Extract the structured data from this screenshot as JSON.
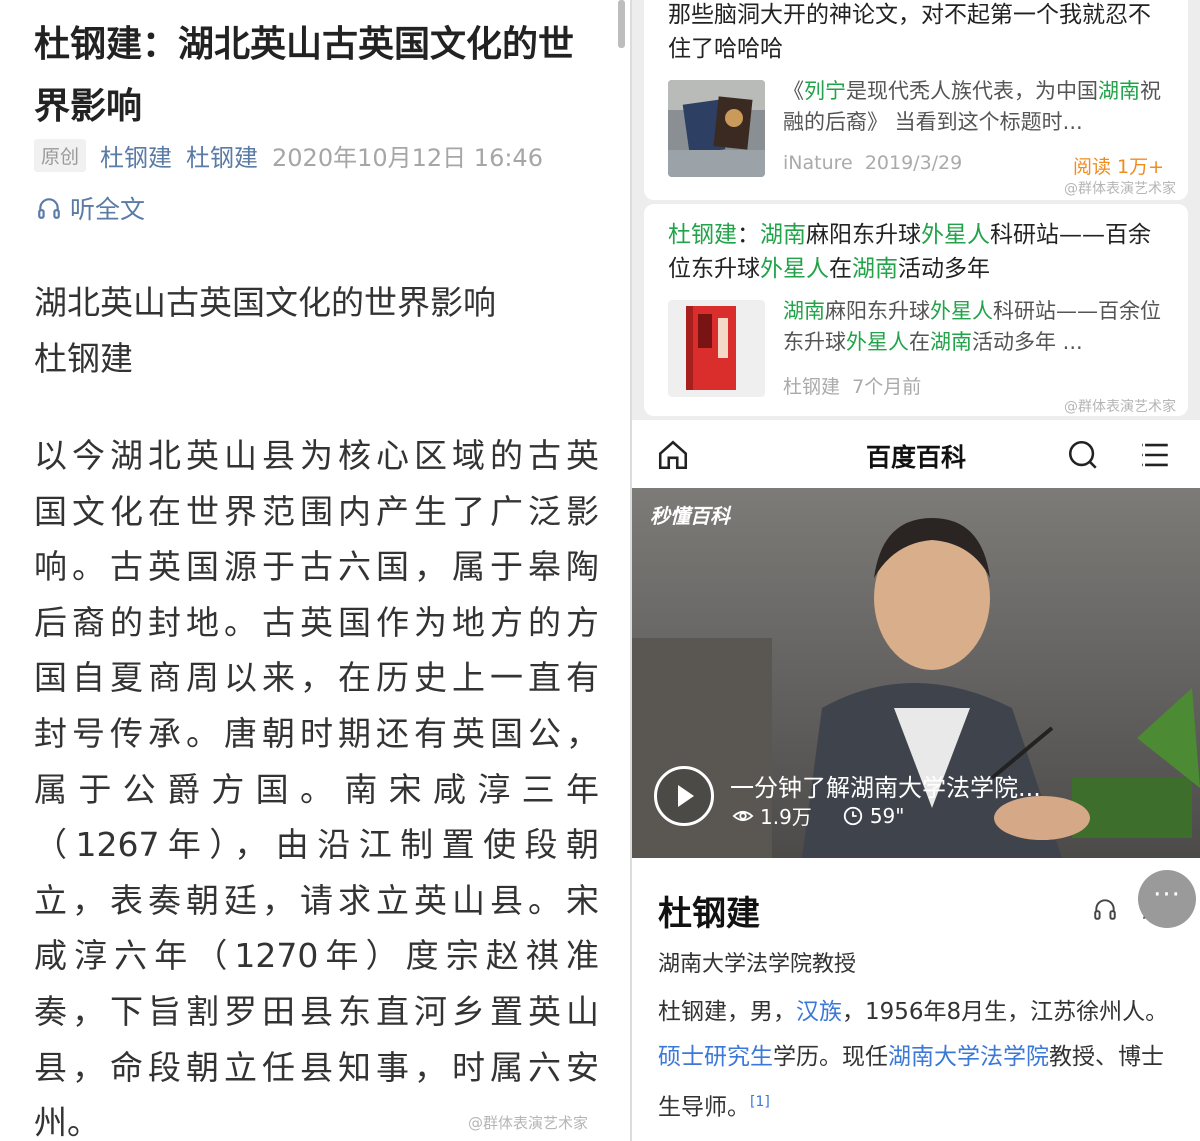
{
  "article": {
    "title": "杜钢建：湖北英山古英国文化的世界影响",
    "badge": "原创",
    "author1": "杜钢建",
    "author2": "杜钢建",
    "datetime": "2020年10月12日 16:46",
    "listen_label": "听全文",
    "subtitle": "湖北英山古英国文化的世界影响",
    "byline": "杜钢建",
    "body_lines": [
      "以今湖北英山县为核心区域的古英",
      "国文化在世界范围内产生了广泛影",
      "响。古英国源于古六国，属于皋陶",
      "后裔的封地。古英国作为地方的方",
      "国自夏商周以来，在历史上一直有",
      "封号传承。唐朝时期还有英国公，",
      "属于公爵方国。南宋咸淳三年",
      "（1267年），由沿江制置使段朝",
      "立，表奏朝廷，请求立英山县。宋",
      "咸淳六年（1270年）度宗赵祺准",
      "奏，下旨割罗田县东直河乡置英山",
      "县，命段朝立任县知事，时属六安",
      "州。"
    ],
    "watermark": "@群体表演艺术家"
  },
  "feed": {
    "card1": {
      "title": "那些脑洞大开的神论文，对不起第一个我就忍不住了哈哈哈",
      "desc_parts": [
        {
          "t": "《",
          "hl": false
        },
        {
          "t": "列宁",
          "hl": true
        },
        {
          "t": "是现代秃人族代表，为中国",
          "hl": false
        },
        {
          "t": "湖南",
          "hl": true
        },
        {
          "t": "祝融的后裔》 当看到这个标题时...",
          "hl": false
        }
      ],
      "source": "iNature",
      "date": "2019/3/29",
      "reads": "阅读 1万+",
      "watermark": "@群体表演艺术家"
    },
    "card2": {
      "title_parts": [
        {
          "t": "杜钢建",
          "hl": true
        },
        {
          "t": "：",
          "hl": false
        },
        {
          "t": "湖南",
          "hl": true
        },
        {
          "t": "麻阳东升球",
          "hl": false
        },
        {
          "t": "外星人",
          "hl": true
        },
        {
          "t": "科研站——百余位东升球",
          "hl": false
        },
        {
          "t": "外星人",
          "hl": true
        },
        {
          "t": "在",
          "hl": false
        },
        {
          "t": "湖南",
          "hl": true
        },
        {
          "t": "活动多年",
          "hl": false
        }
      ],
      "desc_parts": [
        {
          "t": "湖南",
          "hl": true
        },
        {
          "t": "麻阳东升球",
          "hl": false
        },
        {
          "t": "外星人",
          "hl": true
        },
        {
          "t": "科研站——百余位东升球",
          "hl": false
        },
        {
          "t": "外星人",
          "hl": true
        },
        {
          "t": "在",
          "hl": false
        },
        {
          "t": "湖南",
          "hl": true
        },
        {
          "t": "活动多年 ...",
          "hl": false
        }
      ],
      "source": "杜钢建",
      "date": "7个月前",
      "watermark": "@群体表演艺术家"
    }
  },
  "baike": {
    "header_title": "百度百科",
    "video": {
      "brand": "秒懂百科",
      "title": "一分钟了解湖南大学法学院...",
      "views": "1.9万",
      "duration": "59\""
    },
    "entry": {
      "name": "杜钢建",
      "subtitle": "湖南大学法学院教授",
      "desc_parts": [
        {
          "t": "杜钢建，男，",
          "lk": false
        },
        {
          "t": "汉族",
          "lk": true
        },
        {
          "t": "，1956年8月生，江苏徐州人。",
          "lk": false
        },
        {
          "t": "硕士研究生",
          "lk": true
        },
        {
          "t": "学历。现任",
          "lk": false
        },
        {
          "t": "湖南大学法学院",
          "lk": true
        },
        {
          "t": "教授、博士生导师。",
          "lk": false
        }
      ],
      "ref": "[1]"
    },
    "more_label": "···"
  },
  "colors": {
    "highlight_green": "#22a34a",
    "link_blue": "#3b78d8",
    "meta_blue": "#5a7ba6",
    "reads_orange": "#f08c1e"
  },
  "icons": [
    "headphones-icon",
    "home-icon",
    "search-icon",
    "menu-icon",
    "play-icon",
    "eye-icon",
    "clock-icon",
    "pencil-icon"
  ]
}
